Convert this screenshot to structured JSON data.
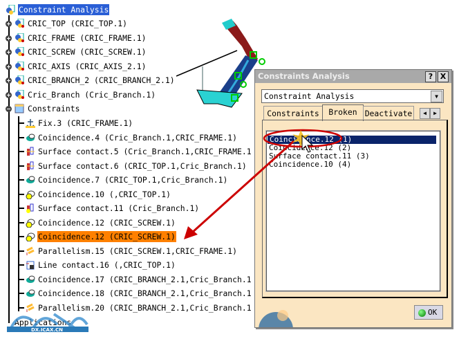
{
  "tree": {
    "root": "Constraint Analysis",
    "products": [
      {
        "label": "CRIC_TOP (CRIC_TOP.1)"
      },
      {
        "label": "CRIC_FRAME (CRIC_FRAME.1)"
      },
      {
        "label": "CRIC_SCREW (CRIC_SCREW.1)"
      },
      {
        "label": "CRIC_AXIS (CRIC_AXIS_2.1)"
      },
      {
        "label": "CRIC_BRANCH_2 (CRIC_BRANCH_2.1)"
      },
      {
        "label": "Cric_Branch (Cric_Branch.1)"
      }
    ],
    "constraints_label": "Constraints",
    "constraints": [
      {
        "label": "Fix.3 (CRIC_FRAME.1)",
        "icon": "fix-icon"
      },
      {
        "label": "Coincidence.4 (Cric_Branch.1,CRIC_FRAME.1)",
        "icon": "coincidence-icon"
      },
      {
        "label": "Surface contact.5 (Cric_Branch.1,CRIC_FRAME.1",
        "icon": "surface-contact-icon"
      },
      {
        "label": "Surface contact.6 (CRIC_TOP.1,Cric_Branch.1)",
        "icon": "surface-contact-icon"
      },
      {
        "label": "Coincidence.7 (CRIC_TOP.1,Cric_Branch.1)",
        "icon": "coincidence-icon"
      },
      {
        "label": "Coincidence.10 (,CRIC_TOP.1)",
        "icon": "broken-coincidence-icon"
      },
      {
        "label": "Surface contact.11 (Cric_Branch.1)",
        "icon": "broken-surface-contact-icon"
      },
      {
        "label": "Coincidence.12 (CRIC_SCREW.1)",
        "icon": "broken-coincidence-icon"
      },
      {
        "label": "Coincidence.12 (CRIC_SCREW.1)",
        "icon": "broken-coincidence-icon",
        "highlighted": true
      },
      {
        "label": "Parallelism.15 (CRIC_SCREW.1,CRIC_FRAME.1)",
        "icon": "parallelism-icon"
      },
      {
        "label": "Line contact.16 (,CRIC_TOP.1)",
        "icon": "line-contact-icon"
      },
      {
        "label": "Coincidence.17 (CRIC_BRANCH_2.1,Cric_Branch.1",
        "icon": "coincidence-icon"
      },
      {
        "label": "Coincidence.18 (CRIC_BRANCH_2.1,Cric_Branch.1",
        "icon": "coincidence-icon"
      },
      {
        "label": "Parallelism.20 (CRIC_BRANCH_2.1,Cric_Branch.1",
        "icon": "parallelism-icon"
      }
    ],
    "applications_label": "Applications"
  },
  "dialog": {
    "title": "Constraints Analysis",
    "help": "?",
    "close": "X",
    "combo_value": "Constraint Analysis",
    "tabs": [
      "Constraints",
      "Broken",
      "Deactivate"
    ],
    "active_tab": "Broken",
    "list": [
      "Coincidence.12 (1)",
      "Coincidence.12 (2)",
      "Surface contact.11 (3)",
      "Coincidence.10 (4)"
    ],
    "selected_index": 0,
    "ok_label": "OK"
  },
  "watermark": "DX.ICAX.CN",
  "colors": {
    "selection": "#0a246a",
    "highlight": "#ff8000",
    "arrow": "#c00000"
  }
}
